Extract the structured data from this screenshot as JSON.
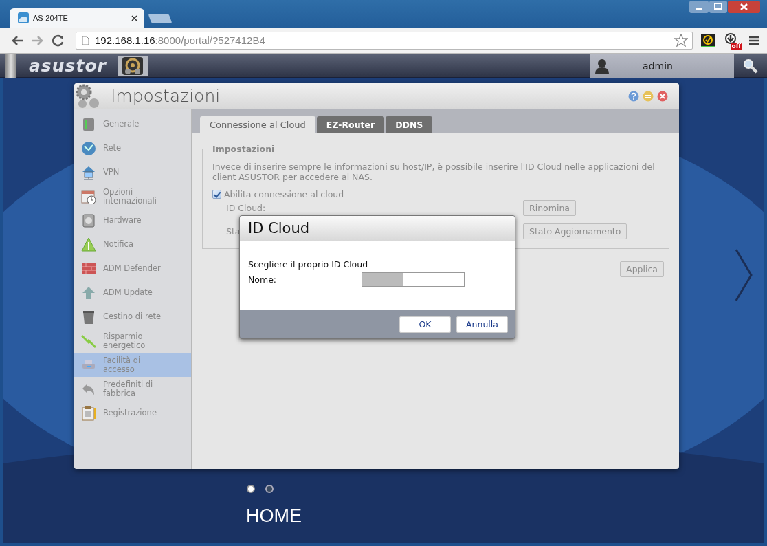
{
  "browser": {
    "tab_title": "AS-204TE",
    "url_host": "192.168.1.16",
    "url_rest": ":8000/portal/?527412B4",
    "extension_badge": "off"
  },
  "adm_bar": {
    "logo": "asustor",
    "user": "admin"
  },
  "settings_window": {
    "title": "Impostazioni",
    "sidebar": {
      "items": [
        {
          "label": "Generale",
          "selected": false
        },
        {
          "label": "Rete",
          "selected": false
        },
        {
          "label": "VPN",
          "selected": false
        },
        {
          "label": "Opzioni internazionali",
          "selected": false
        },
        {
          "label": "Hardware",
          "selected": false
        },
        {
          "label": "Notifica",
          "selected": false
        },
        {
          "label": "ADM Defender",
          "selected": false
        },
        {
          "label": "ADM Update",
          "selected": false
        },
        {
          "label": "Cestino di rete",
          "selected": false
        },
        {
          "label": "Risparmio energetico",
          "selected": false
        },
        {
          "label": "Facilità di accesso",
          "selected": true
        },
        {
          "label": "Predefiniti di fabbrica",
          "selected": false
        },
        {
          "label": "Registrazione",
          "selected": false
        }
      ]
    },
    "tabs": [
      {
        "label": "Connessione al Cloud",
        "selected": true
      },
      {
        "label": "EZ-Router",
        "selected": false
      },
      {
        "label": "DDNS",
        "selected": false
      }
    ],
    "fieldset": {
      "legend": "Impostazioni",
      "description": "Invece di inserire sempre le informazioni su host/IP, è possibile inserire l'ID Cloud nelle applicazioni del client ASUSTOR per accedere al NAS.",
      "enable_checkbox": {
        "label": "Abilita connessione al cloud",
        "checked": true
      },
      "id_cloud_label": "ID Cloud:",
      "status_label": "Sta",
      "rename_button": "Rinomina",
      "update_status_button": "Stato Aggiornamento"
    },
    "apply_button": "Applica"
  },
  "dialog": {
    "title": "ID Cloud",
    "prompt": "Scegliere il proprio ID Cloud",
    "name_label": "Nome:",
    "buttons": [
      "OK",
      "Annulla"
    ]
  },
  "desktop": {
    "pages": [
      {
        "selected": true
      },
      {
        "selected": false
      }
    ],
    "label": "HOME"
  }
}
